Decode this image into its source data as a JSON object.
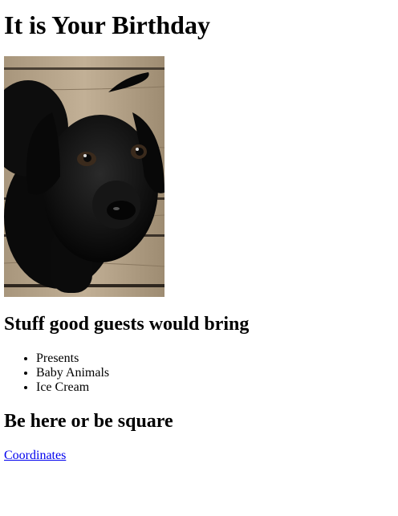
{
  "page": {
    "title": "It is Your Birthday",
    "photo_alt": "black puppy on wooden floor"
  },
  "guests": {
    "heading": "Stuff good guests would bring",
    "items": [
      "Presents",
      "Baby Animals",
      "Ice Cream"
    ]
  },
  "location": {
    "heading": "Be here or be square",
    "link_text": "Coordinates"
  },
  "colors": {
    "link": "#0000ee",
    "text": "#000000",
    "background": "#ffffff"
  }
}
